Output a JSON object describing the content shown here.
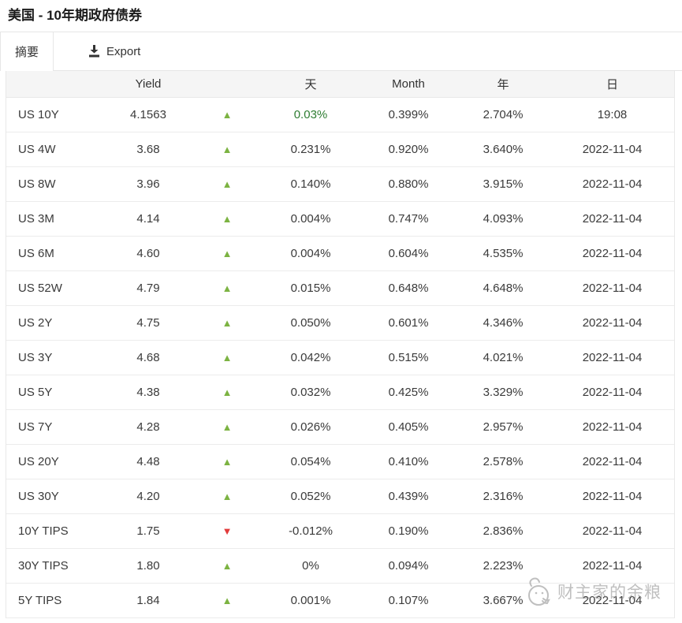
{
  "header": {
    "title": "美国 - 10年期政府债券"
  },
  "toolbar": {
    "summary_tab": "摘要",
    "export_label": "Export"
  },
  "table": {
    "columns": {
      "name": "",
      "yield": "Yield",
      "change": "",
      "day": "天",
      "month": "Month",
      "year": "年",
      "date": "日"
    },
    "rows": [
      {
        "name": "US 10Y",
        "yield": "4.1563",
        "direction": "up",
        "day": "0.03%",
        "day_color": "green",
        "month": "0.399%",
        "year": "2.704%",
        "date": "19:08"
      },
      {
        "name": "US 4W",
        "yield": "3.68",
        "direction": "up",
        "day": "0.231%",
        "month": "0.920%",
        "year": "3.640%",
        "date": "2022-11-04"
      },
      {
        "name": "US 8W",
        "yield": "3.96",
        "direction": "up",
        "day": "0.140%",
        "month": "0.880%",
        "year": "3.915%",
        "date": "2022-11-04"
      },
      {
        "name": "US 3M",
        "yield": "4.14",
        "direction": "up",
        "day": "0.004%",
        "month": "0.747%",
        "year": "4.093%",
        "date": "2022-11-04"
      },
      {
        "name": "US 6M",
        "yield": "4.60",
        "direction": "up",
        "day": "0.004%",
        "month": "0.604%",
        "year": "4.535%",
        "date": "2022-11-04"
      },
      {
        "name": "US 52W",
        "yield": "4.79",
        "direction": "up",
        "day": "0.015%",
        "month": "0.648%",
        "year": "4.648%",
        "date": "2022-11-04"
      },
      {
        "name": "US 2Y",
        "yield": "4.75",
        "direction": "up",
        "day": "0.050%",
        "month": "0.601%",
        "year": "4.346%",
        "date": "2022-11-04"
      },
      {
        "name": "US 3Y",
        "yield": "4.68",
        "direction": "up",
        "day": "0.042%",
        "month": "0.515%",
        "year": "4.021%",
        "date": "2022-11-04"
      },
      {
        "name": "US 5Y",
        "yield": "4.38",
        "direction": "up",
        "day": "0.032%",
        "month": "0.425%",
        "year": "3.329%",
        "date": "2022-11-04"
      },
      {
        "name": "US 7Y",
        "yield": "4.28",
        "direction": "up",
        "day": "0.026%",
        "month": "0.405%",
        "year": "2.957%",
        "date": "2022-11-04"
      },
      {
        "name": "US 20Y",
        "yield": "4.48",
        "direction": "up",
        "day": "0.054%",
        "month": "0.410%",
        "year": "2.578%",
        "date": "2022-11-04"
      },
      {
        "name": "US 30Y",
        "yield": "4.20",
        "direction": "up",
        "day": "0.052%",
        "month": "0.439%",
        "year": "2.316%",
        "date": "2022-11-04"
      },
      {
        "name": "10Y TIPS",
        "yield": "1.75",
        "direction": "down",
        "day": "-0.012%",
        "month": "0.190%",
        "year": "2.836%",
        "date": "2022-11-04"
      },
      {
        "name": "30Y TIPS",
        "yield": "1.80",
        "direction": "up",
        "day": "0%",
        "month": "0.094%",
        "year": "2.223%",
        "date": "2022-11-04"
      },
      {
        "name": "5Y TIPS",
        "yield": "1.84",
        "direction": "up",
        "day": "0.001%",
        "month": "0.107%",
        "year": "3.667%",
        "date": "2022-11-04"
      }
    ]
  },
  "icons": {
    "up": "▲",
    "down": "▼",
    "download": "download-icon"
  },
  "watermark": {
    "text": "财主家的余粮"
  },
  "colors": {
    "up_green": "#7cb342",
    "down_red": "#e23b3b",
    "day_green_text": "#2e7d32",
    "header_bg": "#f5f5f5",
    "border": "#e6e6e6"
  }
}
